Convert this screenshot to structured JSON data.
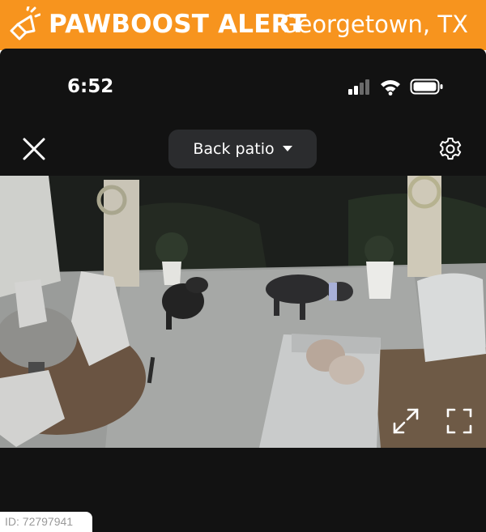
{
  "banner": {
    "brand": "PAWBOOST ALERT",
    "location": "Georgetown, TX",
    "icon": "megaphone-icon",
    "color": "#f7941e"
  },
  "status_bar": {
    "time": "6:52",
    "icons": [
      "cellular-signal-icon",
      "wifi-icon",
      "battery-icon"
    ]
  },
  "camera_header": {
    "close_icon": "close-icon",
    "camera_name": "Back patio",
    "dropdown_icon": "caret-down-icon",
    "settings_icon": "gear-icon"
  },
  "video": {
    "scene": "night patio camera feed with two dogs",
    "controls": [
      "expand-icon",
      "fullscreen-icon"
    ]
  },
  "footer": {
    "id_label": "ID: 72797941"
  }
}
